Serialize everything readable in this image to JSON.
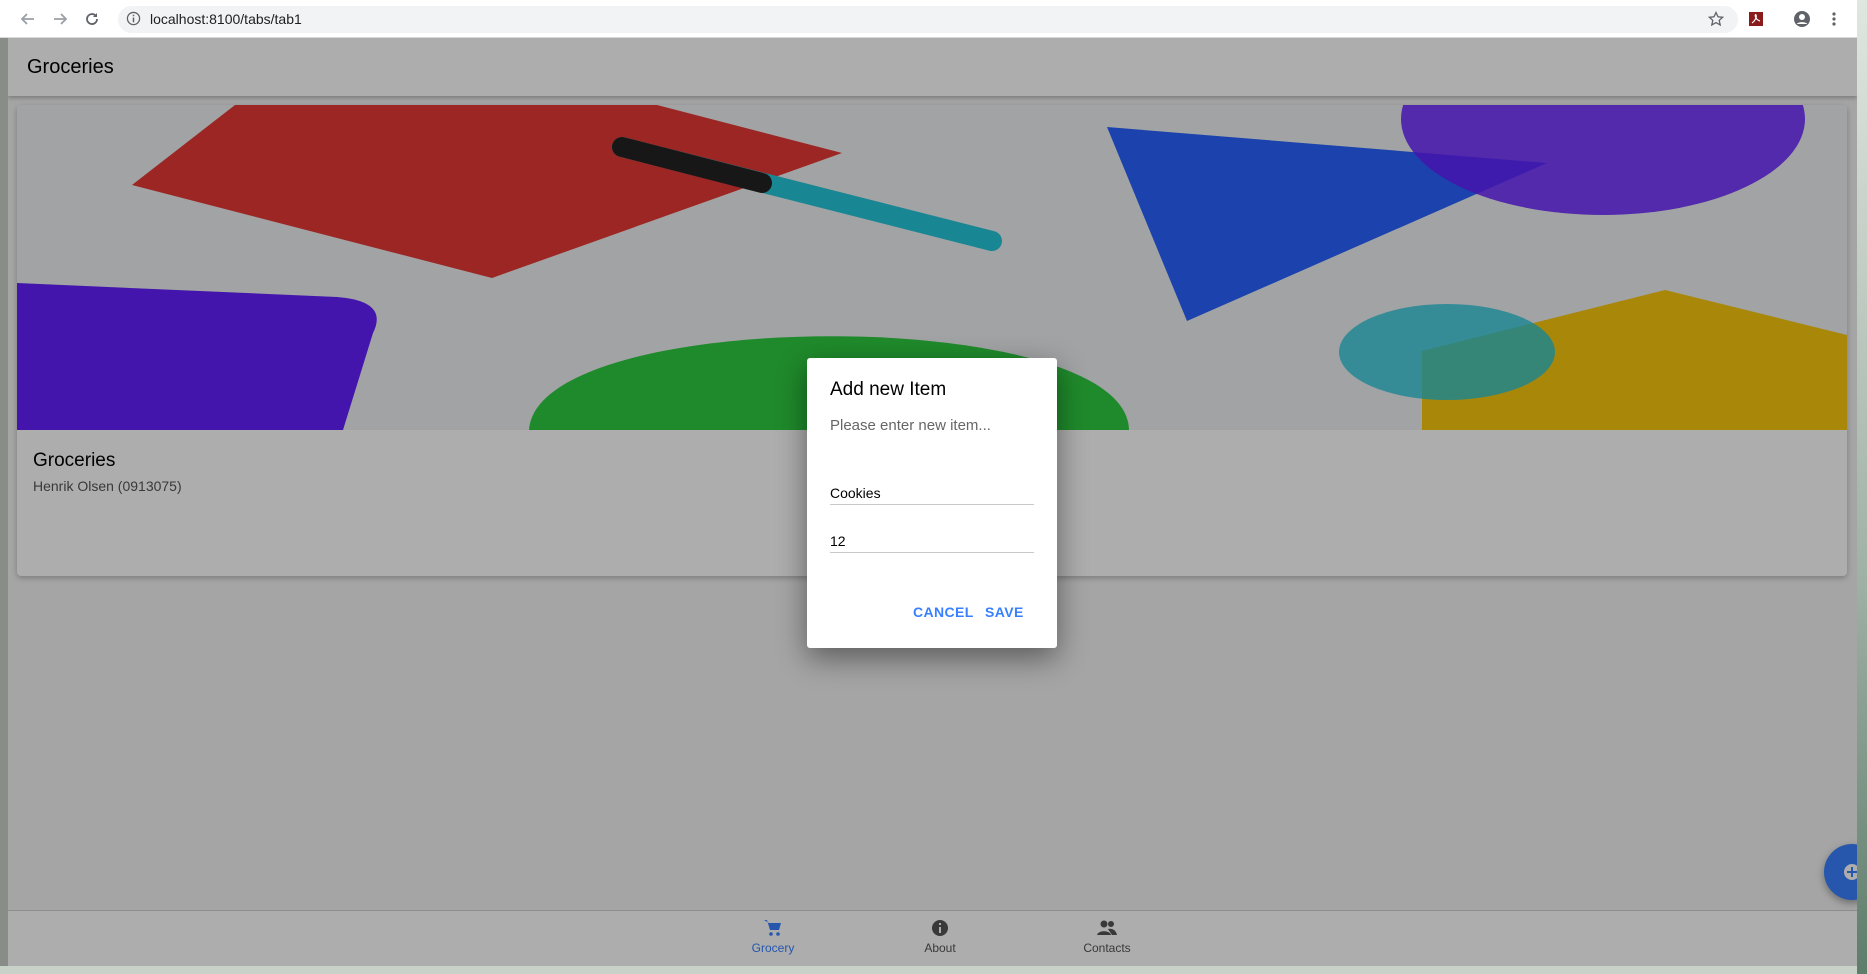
{
  "browser": {
    "url": "localhost:8100/tabs/tab1"
  },
  "toolbar": {
    "title": "Groceries"
  },
  "card": {
    "title": "Groceries",
    "subtitle": "Henrik Olsen (0913075)"
  },
  "dialog": {
    "title": "Add new Item",
    "message": "Please enter new item...",
    "item_value": "Cookies",
    "quantity_value": "12",
    "cancel_label": "CANCEL",
    "save_label": "SAVE"
  },
  "tabs": [
    {
      "label": "Grocery",
      "icon": "cart-icon",
      "active": true
    },
    {
      "label": "About",
      "icon": "info-icon",
      "active": false
    },
    {
      "label": "Contacts",
      "icon": "people-icon",
      "active": false
    }
  ],
  "colors": {
    "accent": "#3880ff",
    "hero_red": "#e53935",
    "hero_teal": "#26c6da",
    "hero_purple": "#651fff",
    "hero_blue": "#2962ff",
    "hero_green": "#2ecc40",
    "hero_yellow": "#f9c80e"
  }
}
